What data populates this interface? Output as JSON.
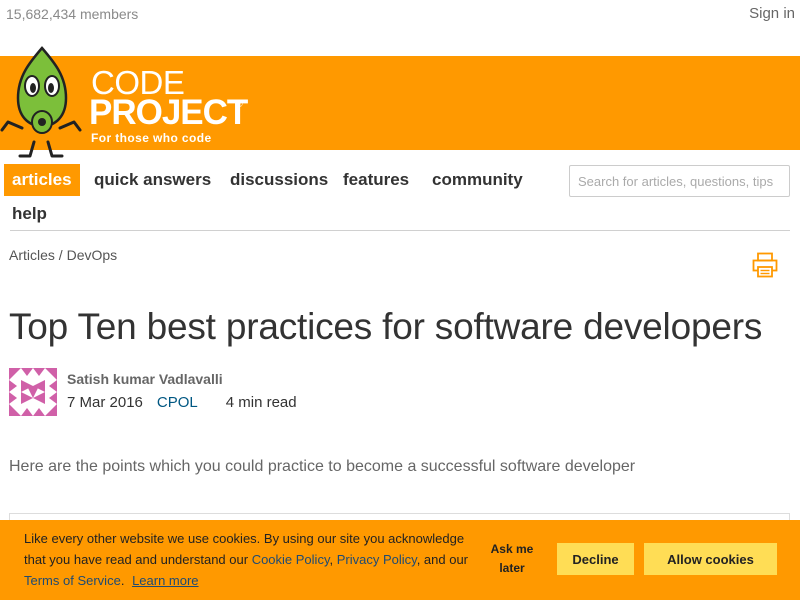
{
  "header": {
    "members_count": "15,682,434 members",
    "sign_in_label": "Sign in"
  },
  "brand": {
    "logo_line1": "CODE",
    "logo_line2": "PROJECT",
    "logo_reg": "®",
    "tagline": "For those who code",
    "accent_color": "#ff9900"
  },
  "nav": {
    "items": [
      {
        "label": "articles",
        "active": true
      },
      {
        "label": "quick answers",
        "active": false
      },
      {
        "label": "discussions",
        "active": false
      },
      {
        "label": "features",
        "active": false
      },
      {
        "label": "community",
        "active": false
      },
      {
        "label": "help",
        "active": false
      }
    ],
    "search_placeholder": "Search for articles, questions, tips"
  },
  "breadcrumb": {
    "section": "Articles",
    "separator": " / ",
    "category": "DevOps"
  },
  "article": {
    "title": "Top Ten best practices for software developers",
    "author": "Satish kumar Vadlavalli",
    "date": "7 Mar 2016",
    "license": "CPOL",
    "read_time": "4 min read",
    "summary": "Here are the points which you could practice to become a successful software developer"
  },
  "cookie_banner": {
    "text_part1": "Like every other website we use cookies. By using our site you acknowledge that you have read and understand our",
    "cookie_policy": "Cookie Policy",
    "comma": ",",
    "privacy_policy": "Privacy Policy",
    "and_our": ", and our",
    "terms": "Terms of Service",
    "period": ".",
    "learn_more": "Learn more",
    "ask_later": "Ask me later",
    "decline": "Decline",
    "allow": "Allow cookies"
  },
  "icons": {
    "print": "printer-icon",
    "mascot": "bob-mascot-icon",
    "avatar": "identicon-avatar"
  }
}
